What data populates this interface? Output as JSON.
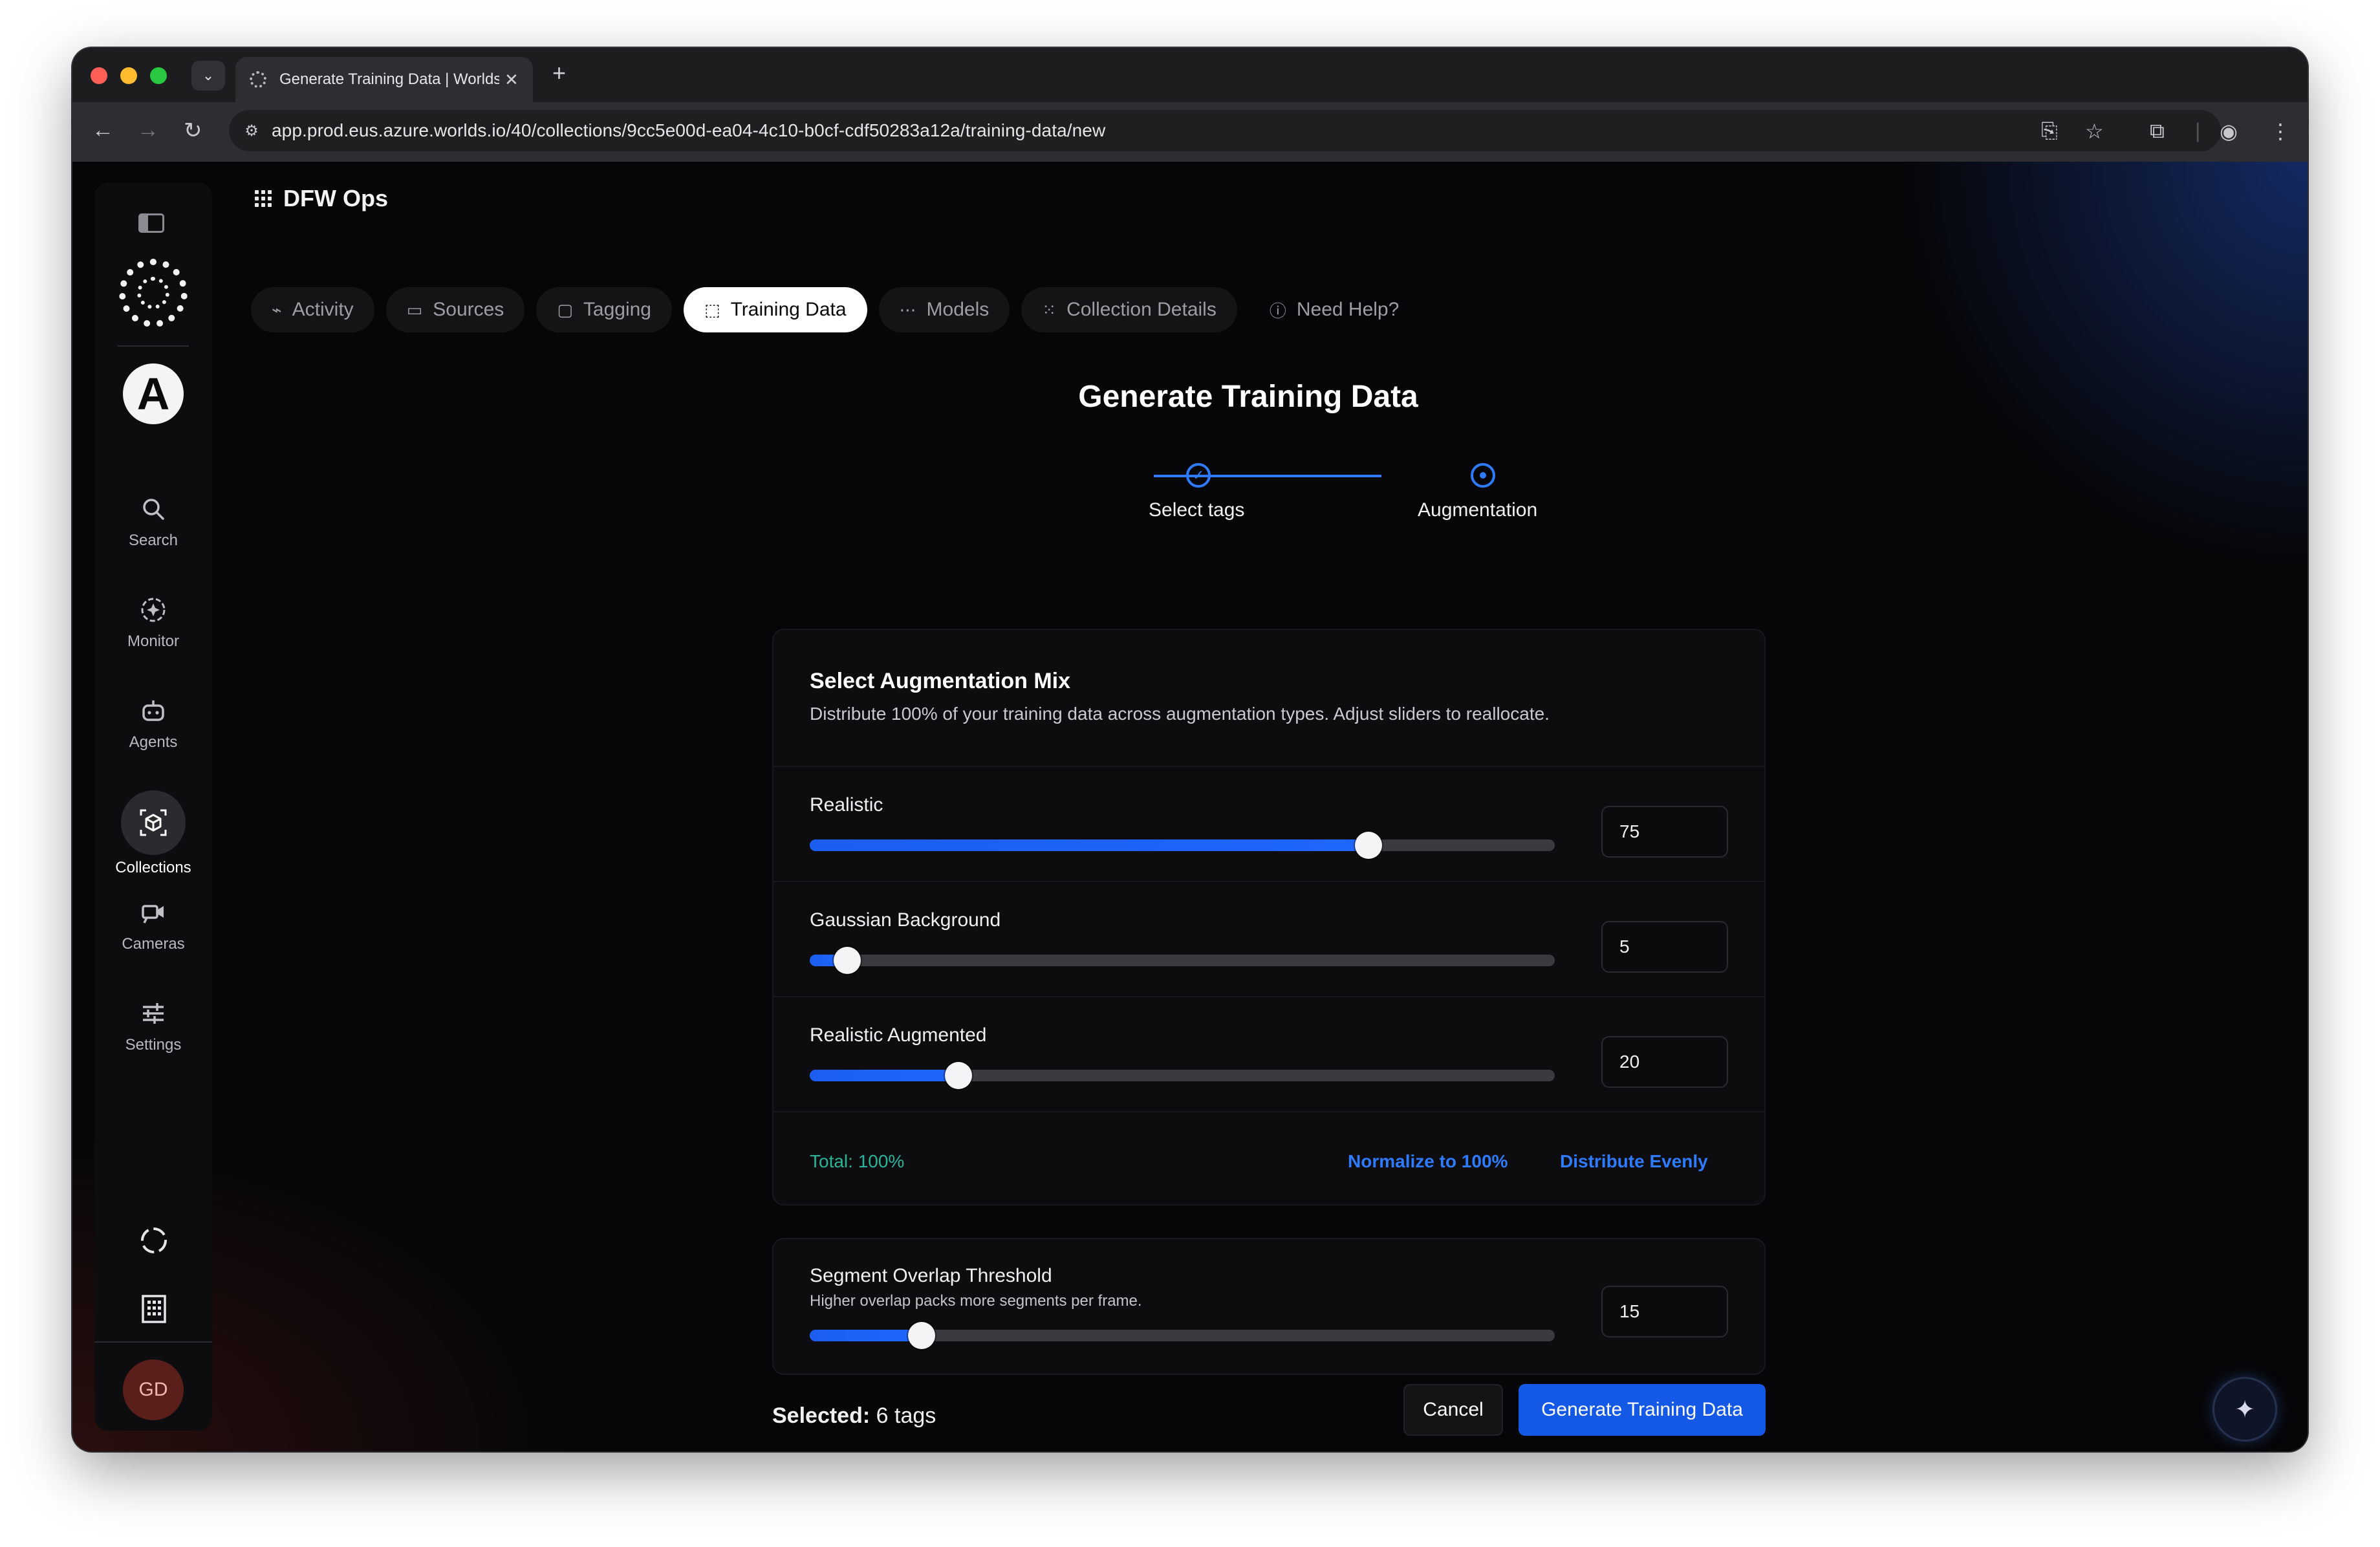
{
  "browser": {
    "tab_title": "Generate Training Data | Worlds",
    "url": "app.prod.eus.azure.worlds.io/40/collections/9cc5e00d-ea04-4c10-b0cf-cdf50283a12a/training-data/new"
  },
  "sidebar": {
    "org_initial": "A",
    "items": [
      {
        "label": "Search",
        "icon": "search-icon"
      },
      {
        "label": "Monitor",
        "icon": "monitor-icon"
      },
      {
        "label": "Agents",
        "icon": "robot-icon"
      },
      {
        "label": "Collections",
        "icon": "cube-icon"
      },
      {
        "label": "Cameras",
        "icon": "camera-icon"
      },
      {
        "label": "Settings",
        "icon": "sliders-icon"
      }
    ],
    "active": "Collections",
    "avatar": "GD"
  },
  "header": {
    "org_title": "DFW Ops",
    "tabs": [
      {
        "label": "Activity",
        "icon": "activity-icon"
      },
      {
        "label": "Sources",
        "icon": "folder-icon"
      },
      {
        "label": "Tagging",
        "icon": "tag-icon"
      },
      {
        "label": "Training Data",
        "icon": "dataset-icon"
      },
      {
        "label": "Models",
        "icon": "models-icon"
      },
      {
        "label": "Collection Details",
        "icon": "grid-icon"
      }
    ],
    "active_tab": "Training Data",
    "help_label": "Need Help?"
  },
  "page": {
    "title": "Generate Training Data",
    "steps": [
      {
        "label": "Select tags",
        "state": "complete"
      },
      {
        "label": "Augmentation",
        "state": "current"
      }
    ]
  },
  "augmentation": {
    "title": "Select Augmentation Mix",
    "description": "Distribute 100% of your training data across augmentation types. Adjust sliders to reallocate.",
    "sliders": [
      {
        "label": "Realistic",
        "value": "75",
        "percent": 75
      },
      {
        "label": "Gaussian Background",
        "value": "5",
        "percent": 5
      },
      {
        "label": "Realistic Augmented",
        "value": "20",
        "percent": 20
      }
    ],
    "total": "Total: 100%",
    "normalize_label": "Normalize to 100%",
    "distribute_label": "Distribute Evenly"
  },
  "overlap": {
    "title": "Segment Overlap Threshold",
    "description": "Higher overlap packs more segments per frame.",
    "value": "15",
    "percent": 15
  },
  "footer": {
    "selected_prefix": "Selected:",
    "selected_value": "6 tags",
    "cancel_label": "Cancel",
    "generate_label": "Generate Training Data"
  },
  "colors": {
    "accent": "#1f66ff",
    "primary_button": "#1458e6",
    "total_ok": "#2bb39a"
  }
}
